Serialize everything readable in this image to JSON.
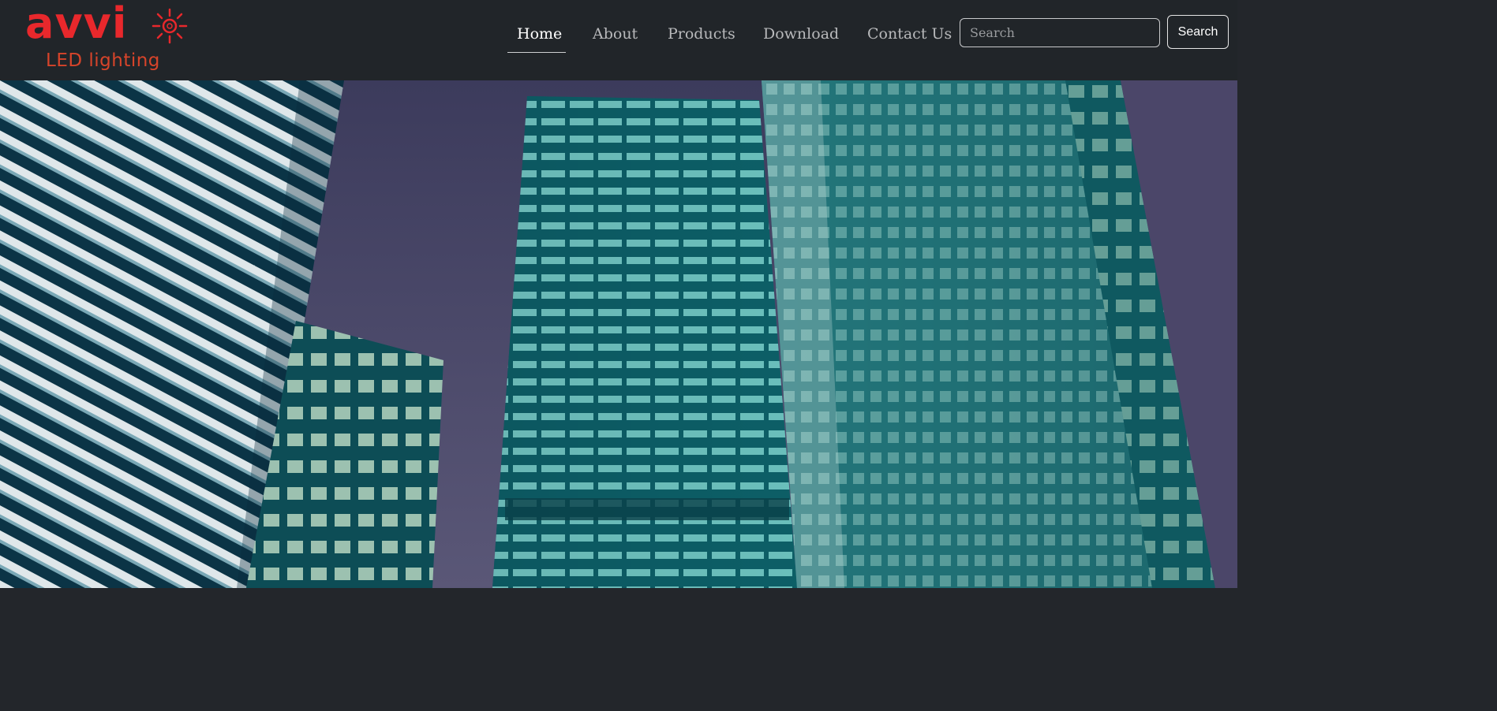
{
  "brand": {
    "logo_word": "avvi",
    "logo_sub": "LED lighting"
  },
  "nav": {
    "items": [
      {
        "label": "Home",
        "active": true
      },
      {
        "label": "About",
        "active": false
      },
      {
        "label": "Products",
        "active": false
      },
      {
        "label": "Download",
        "active": false
      },
      {
        "label": "Contact Us",
        "active": false
      }
    ]
  },
  "search": {
    "placeholder": "Search",
    "value": "",
    "button_label": "Search"
  },
  "colors": {
    "navbar_bg": "#212529",
    "brand_red": "#e8282c",
    "sky": "#4b4a6e",
    "glass": "#0f6e74",
    "lit_window": "#bff7ee"
  },
  "icons": {
    "logo_sun": "sun-icon"
  }
}
